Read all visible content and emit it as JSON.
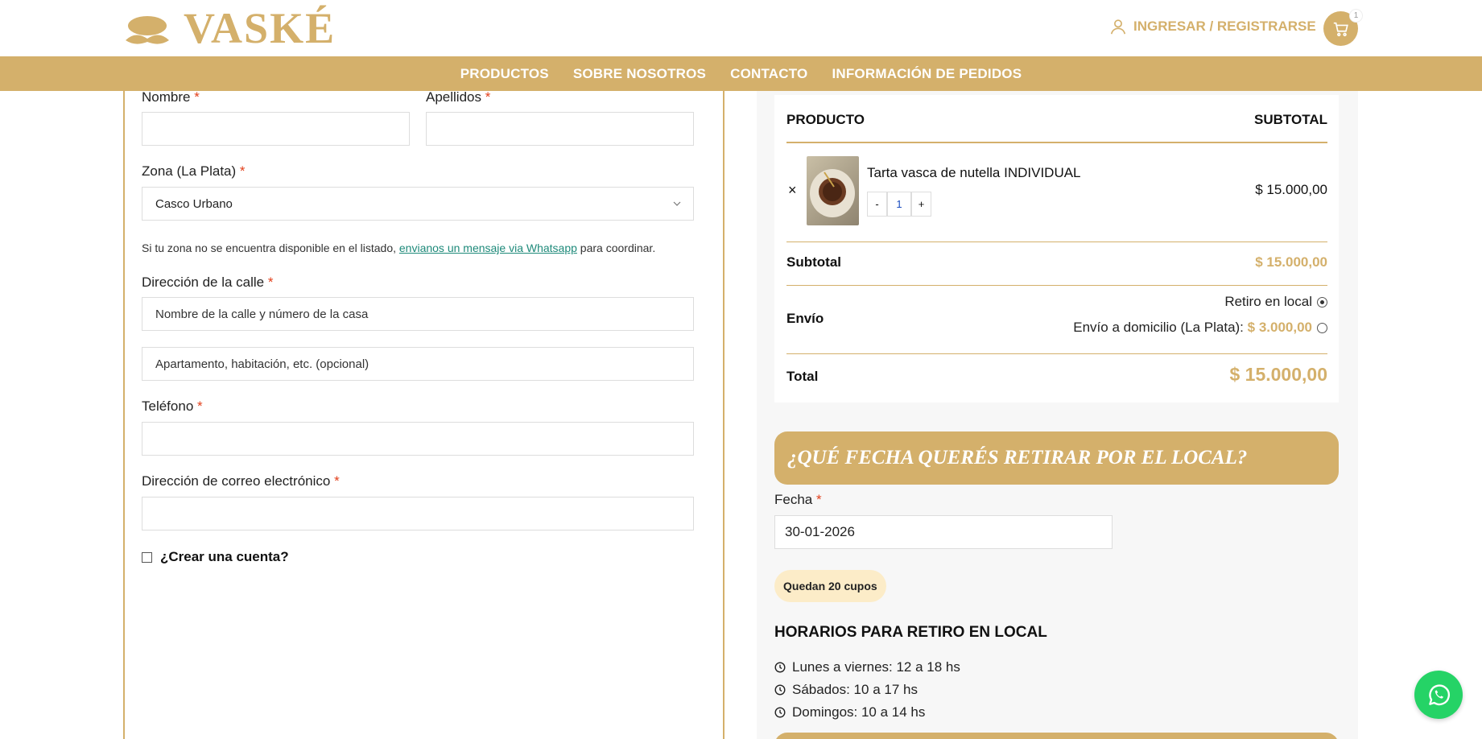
{
  "brand": {
    "name": "VASKÉ",
    "accent": "#d4b06b"
  },
  "header": {
    "login_label": "INGRESAR / REGISTRARSE",
    "cart_count": "1"
  },
  "nav": {
    "items": [
      "PRODUCTOS",
      "SOBRE NOSOTROS",
      "CONTACTO",
      "INFORMACIÓN DE PEDIDOS"
    ]
  },
  "form": {
    "nombre_label": "Nombre",
    "apellidos_label": "Apellidos",
    "zona_label": "Zona (La Plata)",
    "zona_value": "Casco Urbano",
    "zona_note_before": "Si tu zona no se encuentra disponible en el listado, ",
    "zona_note_link": "envianos un mensaje via Whatsapp",
    "zona_note_after": " para coordinar.",
    "calle_label": "Dirección de la calle",
    "calle_placeholder": "Nombre de la calle y número de la casa",
    "apto_placeholder": "Apartamento, habitación, etc. (opcional)",
    "telefono_label": "Teléfono",
    "email_label": "Dirección de correo electrónico",
    "crear_cuenta_label": "¿Crear una cuenta?",
    "required_mark": "*"
  },
  "order": {
    "col_product": "PRODUCTO",
    "col_subtotal": "SUBTOTAL",
    "remove_symbol": "×",
    "product_name": "Tarta vasca de nutella INDIVIDUAL",
    "qty_minus": "-",
    "qty_value": "1",
    "qty_plus": "+",
    "product_price": "$ 15.000,00",
    "subtotal_label": "Subtotal",
    "subtotal_value": "$ 15.000,00",
    "envio_label": "Envío",
    "envio_option_1": "Retiro en local",
    "envio_option_2_label": "Envío a domicilio (La Plata):",
    "envio_option_2_price": "$ 3.000,00",
    "total_label": "Total",
    "total_value": "$ 15.000,00"
  },
  "pickup": {
    "banner": "¿QUÉ FECHA QUERÉS RETIRAR POR EL LOCAL?",
    "fecha_label": "Fecha",
    "fecha_value": "30-01-2026",
    "cupos_badge": "Quedan 20 cupos",
    "horarios_title": "HORARIOS PARA RETIRO EN LOCAL",
    "horarios": [
      "Lunes a viernes: 12 a 18 hs",
      "Sábados: 10 a 17 hs",
      "Domingos: 10 a 14 hs"
    ]
  },
  "icons": {
    "user": "user-icon",
    "cart": "cart-icon",
    "chevron": "chevron-down-icon",
    "clock": "clock-icon",
    "whatsapp": "whatsapp-icon"
  }
}
